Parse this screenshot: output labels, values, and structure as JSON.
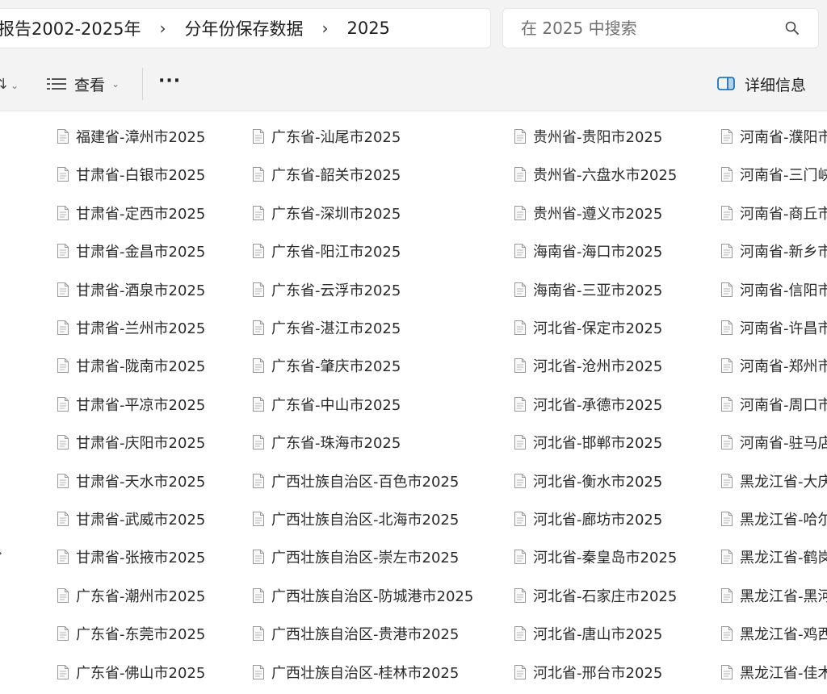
{
  "breadcrumb": {
    "items": [
      "报告2002-2025年",
      "分年份保存数据",
      "2025"
    ],
    "separator": "›"
  },
  "search": {
    "placeholder": "在 2025 中搜索"
  },
  "toolbar": {
    "view_label": "查看",
    "more_label": "···",
    "details_label": "详细信息"
  },
  "colors": {
    "chrome_bg": "#f3f3f3",
    "accent": "#0067c0"
  },
  "files": {
    "columns": [
      [
        "福建省-漳州市2025",
        "甘肃省-白银市2025",
        "甘肃省-定西市2025",
        "甘肃省-金昌市2025",
        "甘肃省-酒泉市2025",
        "甘肃省-兰州市2025",
        "甘肃省-陇南市2025",
        "甘肃省-平凉市2025",
        "甘肃省-庆阳市2025",
        "甘肃省-天水市2025",
        "甘肃省-武威市2025",
        "甘肃省-张掖市2025",
        "广东省-潮州市2025",
        "广东省-东莞市2025",
        "广东省-佛山市2025"
      ],
      [
        "广东省-汕尾市2025",
        "广东省-韶关市2025",
        "广东省-深圳市2025",
        "广东省-阳江市2025",
        "广东省-云浮市2025",
        "广东省-湛江市2025",
        "广东省-肇庆市2025",
        "广东省-中山市2025",
        "广东省-珠海市2025",
        "广西壮族自治区-百色市2025",
        "广西壮族自治区-北海市2025",
        "广西壮族自治区-崇左市2025",
        "广西壮族自治区-防城港市2025",
        "广西壮族自治区-贵港市2025",
        "广西壮族自治区-桂林市2025"
      ],
      [
        "贵州省-贵阳市2025",
        "贵州省-六盘水市2025",
        "贵州省-遵义市2025",
        "海南省-海口市2025",
        "海南省-三亚市2025",
        "河北省-保定市2025",
        "河北省-沧州市2025",
        "河北省-承德市2025",
        "河北省-邯郸市2025",
        "河北省-衡水市2025",
        "河北省-廊坊市2025",
        "河北省-秦皇岛市2025",
        "河北省-石家庄市2025",
        "河北省-唐山市2025",
        "河北省-邢台市2025"
      ],
      [
        "河南省-濮阳市",
        "河南省-三门峡",
        "河南省-商丘市",
        "河南省-新乡市",
        "河南省-信阳市",
        "河南省-许昌市",
        "河南省-郑州市",
        "河南省-周口市",
        "河南省-驻马店",
        "黑龙江省-大庆",
        "黑龙江省-哈尔",
        "黑龙江省-鹤岗",
        "黑龙江省-黑河",
        "黑龙江省-鸡西",
        "黑龙江省-佳木"
      ]
    ]
  }
}
